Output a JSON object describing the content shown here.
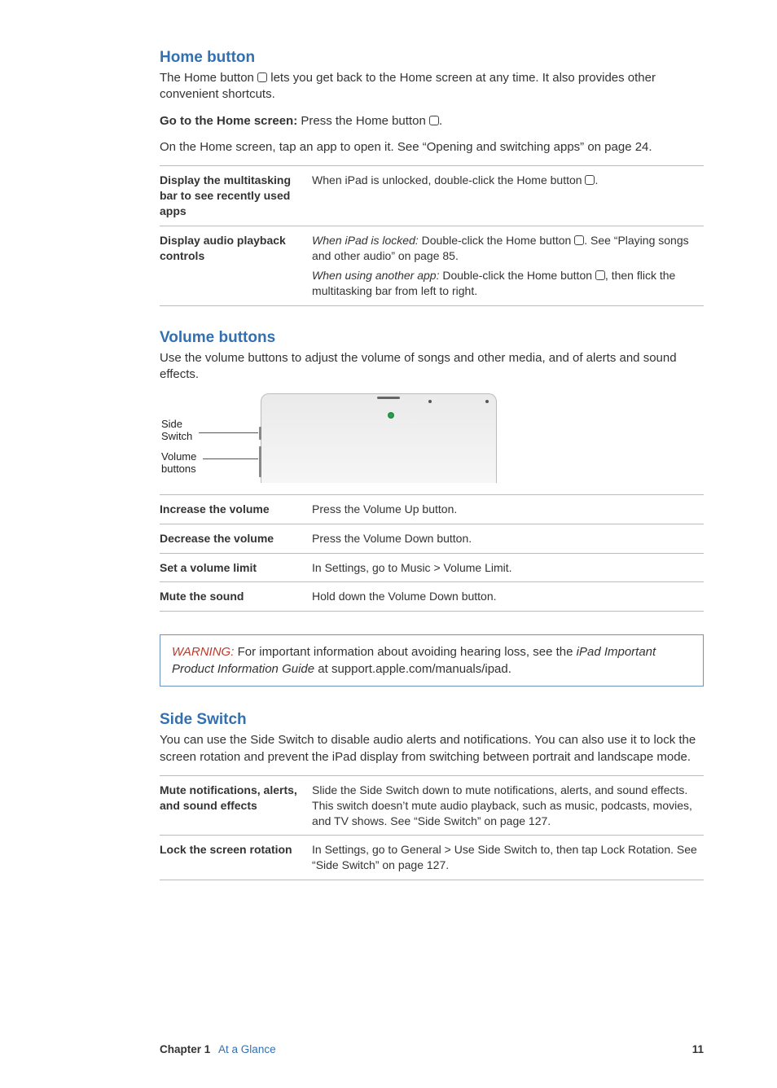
{
  "home_button": {
    "heading": "Home button",
    "para1_a": "The Home button ",
    "para1_b": " lets you get back to the Home screen at any time. It also provides other convenient shortcuts.",
    "go_home_label": "Go to the Home screen:  ",
    "go_home_text_a": "Press the Home button ",
    "go_home_text_b": ".",
    "para2": "On the Home screen, tap an app to open it. See “Opening and switching apps” on page 24.",
    "table": {
      "r1": {
        "label": "Display the multitasking bar to see recently used apps",
        "value_a": "When iPad is unlocked, double-click the Home button ",
        "value_b": "."
      },
      "r2": {
        "label": "Display audio playback controls",
        "locked_lead": "When iPad is locked:  ",
        "locked_text_a": "Double-click the Home button ",
        "locked_text_b": ". See “Playing songs and other audio” on page 85.",
        "other_lead": "When using another app:  ",
        "other_text_a": "Double-click the Home button ",
        "other_text_b": ", then flick the multitasking bar from left to right."
      }
    }
  },
  "volume_buttons": {
    "heading": "Volume buttons",
    "para": "Use the volume buttons to adjust the volume of songs and other media, and of alerts and sound effects.",
    "fig_label_side_l1": "Side",
    "fig_label_side_l2": "Switch",
    "fig_label_vol_l1": "Volume",
    "fig_label_vol_l2": "buttons",
    "table": {
      "r1": {
        "label": "Increase the volume",
        "value": "Press the Volume Up button."
      },
      "r2": {
        "label": "Decrease the volume",
        "value": "Press the Volume Down button."
      },
      "r3": {
        "label": "Set a volume limit",
        "value": "In Settings, go to Music > Volume Limit."
      },
      "r4": {
        "label": "Mute the sound",
        "value": "Hold down the Volume Down button."
      }
    }
  },
  "warning_box": {
    "label": "WARNING:  ",
    "text_a": "For important information about avoiding hearing loss, see the ",
    "text_b": "iPad Important Product Information Guide",
    "text_c": " at support.apple.com/manuals/ipad."
  },
  "side_switch": {
    "heading": "Side Switch",
    "para": "You can use the Side Switch to disable audio alerts and notifications. You can also use it to lock the screen rotation and prevent the iPad display from switching between portrait and landscape mode.",
    "table": {
      "r1": {
        "label": "Mute notifications, alerts, and sound effects",
        "value": "Slide the Side Switch down to mute notifications, alerts, and sound effects. This switch doesn’t mute audio playback, such as music, podcasts, movies, and TV shows. See “Side Switch” on page 127."
      },
      "r2": {
        "label": "Lock the screen rotation",
        "value": "In Settings, go to General > Use Side Switch to, then tap Lock Rotation. See “Side Switch” on page 127."
      }
    }
  },
  "footer": {
    "chapter_label": "Chapter 1",
    "chapter_title": "At a Glance",
    "page_num": "11"
  }
}
